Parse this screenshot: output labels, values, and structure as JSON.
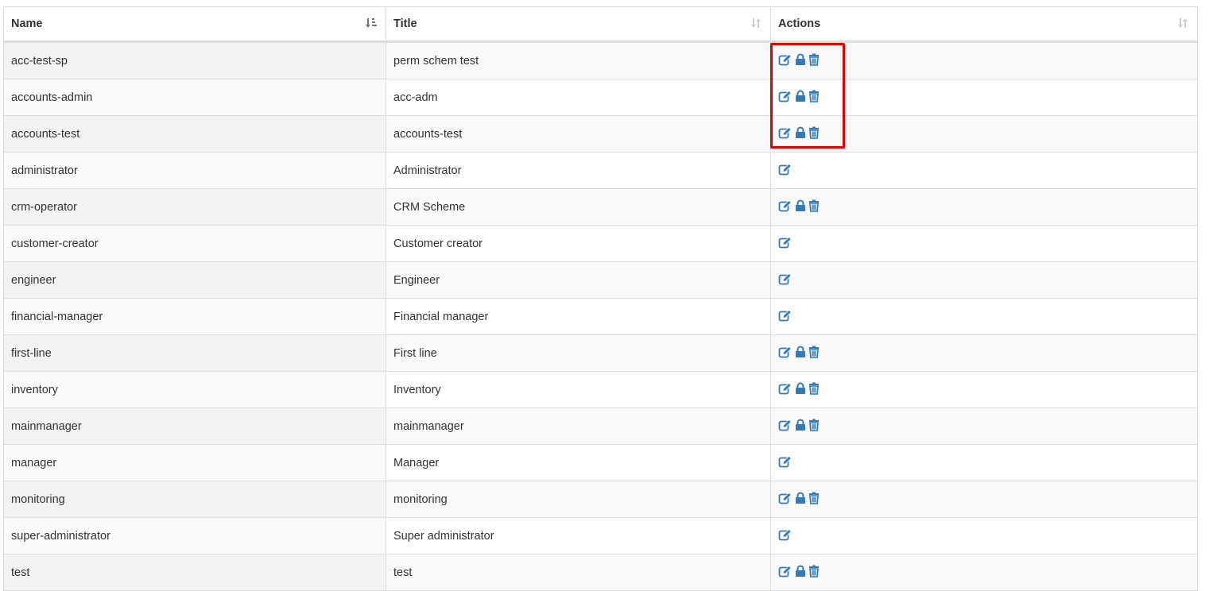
{
  "table": {
    "headers": [
      {
        "label": "Name",
        "sort": "sorted-ascending"
      },
      {
        "label": "Title",
        "sort": "unsorted"
      },
      {
        "label": "Actions",
        "sort": "unsorted"
      }
    ],
    "rows": [
      {
        "name": "acc-test-sp",
        "title": "perm schem test",
        "actions": [
          "edit-icon",
          "lock-icon",
          "trash-icon"
        ]
      },
      {
        "name": "accounts-admin",
        "title": "acc-adm",
        "actions": [
          "edit-icon",
          "lock-icon",
          "trash-icon"
        ]
      },
      {
        "name": "accounts-test",
        "title": "accounts-test",
        "actions": [
          "edit-icon",
          "lock-icon",
          "trash-icon"
        ]
      },
      {
        "name": "administrator",
        "title": "Administrator",
        "actions": [
          "edit-icon"
        ]
      },
      {
        "name": "crm-operator",
        "title": "CRM Scheme",
        "actions": [
          "edit-icon",
          "lock-icon",
          "trash-icon"
        ]
      },
      {
        "name": "customer-creator",
        "title": "Customer creator",
        "actions": [
          "edit-icon"
        ]
      },
      {
        "name": "engineer",
        "title": "Engineer",
        "actions": [
          "edit-icon"
        ]
      },
      {
        "name": "financial-manager",
        "title": "Financial manager",
        "actions": [
          "edit-icon"
        ]
      },
      {
        "name": "first-line",
        "title": "First line",
        "actions": [
          "edit-icon",
          "lock-icon",
          "trash-icon"
        ]
      },
      {
        "name": "inventory",
        "title": "Inventory",
        "actions": [
          "edit-icon",
          "lock-icon",
          "trash-icon"
        ]
      },
      {
        "name": "mainmanager",
        "title": "mainmanager",
        "actions": [
          "edit-icon",
          "lock-icon",
          "trash-icon"
        ]
      },
      {
        "name": "manager",
        "title": "Manager",
        "actions": [
          "edit-icon"
        ]
      },
      {
        "name": "monitoring",
        "title": "monitoring",
        "actions": [
          "edit-icon",
          "lock-icon",
          "trash-icon"
        ]
      },
      {
        "name": "super-administrator",
        "title": "Super administrator",
        "actions": [
          "edit-icon"
        ]
      },
      {
        "name": "test",
        "title": "test",
        "actions": [
          "edit-icon",
          "lock-icon",
          "trash-icon"
        ]
      }
    ]
  },
  "highlight": {
    "color": "#e50000",
    "rows": [
      "acc-test-sp",
      "accounts-admin",
      "accounts-test"
    ],
    "column": "Actions"
  },
  "colors": {
    "icon": "#337ab7",
    "sort_active": "#777777",
    "sort_inactive": "#cccccc"
  }
}
